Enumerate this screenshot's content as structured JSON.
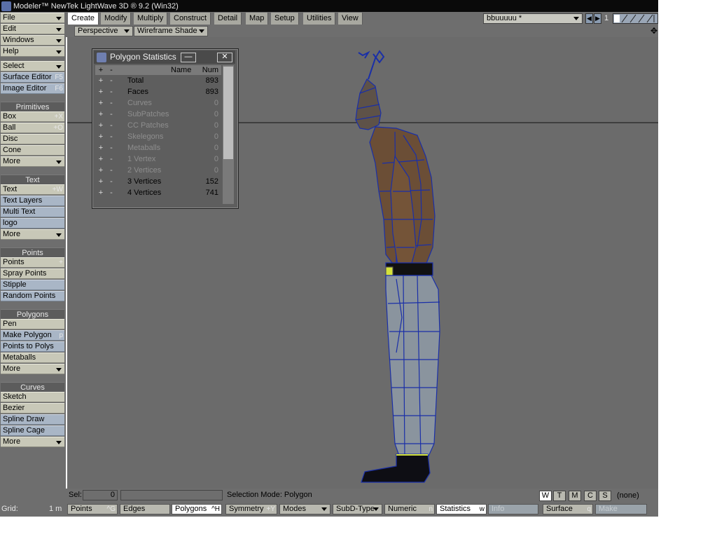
{
  "window": {
    "title": "Modeler™ NewTek LightWave 3D ® 9.2 (Win32)"
  },
  "left_top": [
    {
      "label": "File",
      "dropdown": true
    },
    {
      "label": "Edit",
      "dropdown": true
    },
    {
      "label": "Windows",
      "dropdown": true
    },
    {
      "label": "Help",
      "dropdown": true
    }
  ],
  "left_select": {
    "label": "Select"
  },
  "left_editors": [
    {
      "label": "Surface Editor",
      "shortcut": "F5"
    },
    {
      "label": "Image Editor",
      "shortcut": "F6"
    }
  ],
  "groups": {
    "primitives": {
      "title": "Primitives",
      "items": [
        {
          "label": "Box",
          "shortcut": "+X"
        },
        {
          "label": "Ball",
          "shortcut": "+O"
        },
        {
          "label": "Disc",
          "shortcut": ""
        },
        {
          "label": "Cone",
          "shortcut": ""
        },
        {
          "label": "More",
          "dropdown": true
        }
      ]
    },
    "text": {
      "title": "Text",
      "items": [
        {
          "label": "Text",
          "shortcut": "+W"
        },
        {
          "label": "Text Layers",
          "shortcut": ""
        },
        {
          "label": "Multi Text",
          "shortcut": ""
        },
        {
          "label": "logo",
          "shortcut": ""
        },
        {
          "label": "More",
          "dropdown": true
        }
      ]
    },
    "points": {
      "title": "Points",
      "items": [
        {
          "label": "Points",
          "shortcut": "+"
        },
        {
          "label": "Spray Points",
          "shortcut": ""
        },
        {
          "label": "Stipple",
          "shortcut": ""
        },
        {
          "label": "Random Points",
          "shortcut": ""
        }
      ]
    },
    "polygons": {
      "title": "Polygons",
      "items": [
        {
          "label": "Pen",
          "shortcut": ""
        },
        {
          "label": "Make Polygon",
          "shortcut": "p"
        },
        {
          "label": "Points to Polys",
          "shortcut": ""
        },
        {
          "label": "Metaballs",
          "shortcut": ""
        },
        {
          "label": "More",
          "dropdown": true
        }
      ]
    },
    "curves": {
      "title": "Curves",
      "items": [
        {
          "label": "Sketch",
          "shortcut": ""
        },
        {
          "label": "Bezier",
          "shortcut": ""
        },
        {
          "label": "Spline Draw",
          "shortcut": ""
        },
        {
          "label": "Spline Cage",
          "shortcut": ""
        },
        {
          "label": "More",
          "dropdown": true
        }
      ]
    }
  },
  "tabs": [
    "Create",
    "Modify",
    "Multiply",
    "Construct",
    "Detail",
    "Map",
    "Setup",
    "Utilities",
    "View"
  ],
  "active_tab": "Create",
  "object_select": {
    "value": "bbuuuuu *"
  },
  "layer_number": "1",
  "view": {
    "projection": "Perspective",
    "shading": "Wireframe Shade"
  },
  "stats_panel": {
    "title": "Polygon Statistics",
    "header": {
      "plus": "+",
      "minus": "-",
      "name": "Name",
      "num": "Num"
    },
    "rows": [
      {
        "name": "Total",
        "num": "893",
        "active": true
      },
      {
        "name": "Faces",
        "num": "893",
        "active": true
      },
      {
        "name": "Curves",
        "num": "0",
        "active": false
      },
      {
        "name": "SubPatches",
        "num": "0",
        "active": false
      },
      {
        "name": "CC Patches",
        "num": "0",
        "active": false
      },
      {
        "name": "Skelegons",
        "num": "0",
        "active": false
      },
      {
        "name": "Metaballs",
        "num": "0",
        "active": false
      },
      {
        "name": "1 Vertex",
        "num": "0",
        "active": false
      },
      {
        "name": "2 Vertices",
        "num": "0",
        "active": false
      },
      {
        "name": "3 Vertices",
        "num": "152",
        "active": true
      },
      {
        "name": "4 Vertices",
        "num": "741",
        "active": true
      }
    ]
  },
  "status": {
    "sel_label": "Sel:",
    "sel_value": "0",
    "selection_mode": "Selection Mode:  Polygon",
    "wtmcs": [
      "W",
      "T",
      "M",
      "C",
      "S"
    ],
    "wtmcs_active": "W",
    "none_label": "(none)"
  },
  "bottom": {
    "grid_label": "Grid:",
    "grid_value": "1 m",
    "points": {
      "label": "Points",
      "shortcut": "^G"
    },
    "edges": {
      "label": "Edges"
    },
    "polygons": {
      "label": "Polygons",
      "shortcut": "^H"
    },
    "symmetry": {
      "label": "Symmetry",
      "shortcut": "+Y"
    },
    "modes": {
      "label": "Modes"
    },
    "subd": {
      "label": "SubD-Type"
    },
    "numeric": {
      "label": "Numeric",
      "shortcut": "n"
    },
    "statistics": {
      "label": "Statistics",
      "shortcut": "w"
    },
    "info": {
      "label": "Info"
    },
    "surface": {
      "label": "Surface",
      "shortcut": "q"
    },
    "make": {
      "label": "Make"
    }
  },
  "colors": {
    "panel_gray": "#6e6e6e",
    "button_beige": "#c8c8b8",
    "button_blue": "#a9b6c6",
    "wire_blue": "#1a2fa8"
  }
}
